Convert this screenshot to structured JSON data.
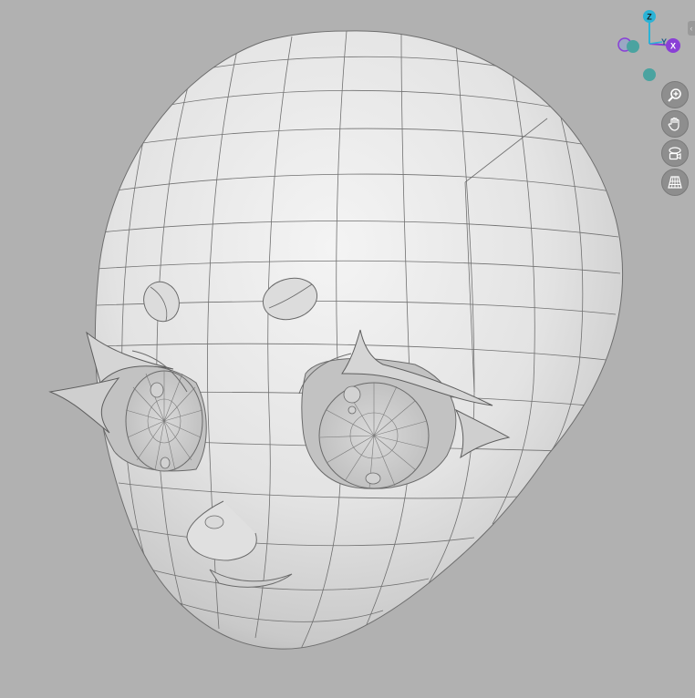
{
  "viewport": {
    "background_color": "#b1b1b1",
    "model_color": "#e8e8e8",
    "wire_color": "#6a6a6a"
  },
  "gizmo": {
    "z_label": "Z",
    "y_label": "Y",
    "x_label": "X",
    "z_color": "#2bb3d6",
    "x_color": "#8a3fd6",
    "y_color": "#2bb3d6",
    "neg_color": "#4aa3a0"
  },
  "tools": [
    {
      "name": "zoom-icon"
    },
    {
      "name": "pan-hand-icon"
    },
    {
      "name": "orbit-camera-icon"
    },
    {
      "name": "perspective-grid-icon"
    }
  ],
  "collapse_tab": {
    "glyph": "‹"
  }
}
